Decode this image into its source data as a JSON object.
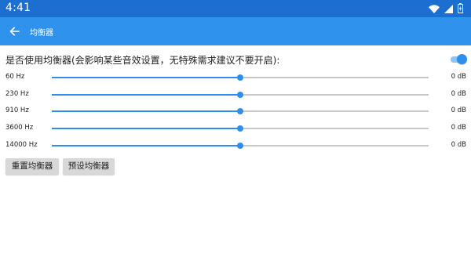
{
  "status_bar": {
    "time": "4:41",
    "icons": [
      "wifi-icon",
      "signal-icon",
      "battery-icon"
    ]
  },
  "app_bar": {
    "title": "均衡器",
    "back_icon": "arrow-back-icon"
  },
  "equalizer": {
    "enable_label": "是否使用均衡器(会影响某些音效设置，无特殊需求建议不要开启):",
    "enabled": true,
    "bands": [
      {
        "freq": "60 Hz",
        "gain": "0 dB",
        "level": 0.5
      },
      {
        "freq": "230 Hz",
        "gain": "0 dB",
        "level": 0.5
      },
      {
        "freq": "910 Hz",
        "gain": "0 dB",
        "level": 0.5
      },
      {
        "freq": "3600 Hz",
        "gain": "0 dB",
        "level": 0.5
      },
      {
        "freq": "14000 Hz",
        "gain": "0 dB",
        "level": 0.5
      }
    ],
    "reset_label": "重置均衡器",
    "preset_label": "预设均衡器"
  },
  "colors": {
    "status_bar": "#1b6fd0",
    "app_bar": "#2f93ee",
    "accent": "#2c8fec",
    "track": "#c8c8c8"
  }
}
